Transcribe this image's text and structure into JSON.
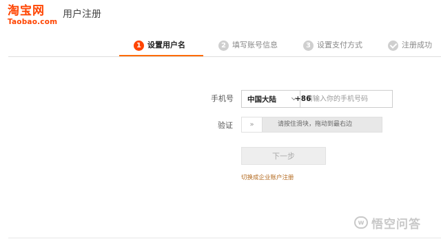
{
  "header": {
    "logo_cn": "淘宝网",
    "logo_en": "Taobao.com",
    "title": "用户注册"
  },
  "steps": [
    {
      "number": "1",
      "label": "设置用户名",
      "state": "active"
    },
    {
      "number": "2",
      "label": "填写账号信息",
      "state": "pending"
    },
    {
      "number": "3",
      "label": "设置支付方式",
      "state": "pending"
    },
    {
      "icon": "check-icon",
      "label": "注册成功",
      "state": "pending"
    }
  ],
  "form": {
    "phone_label": "手机号",
    "region_name": "中国大陆",
    "region_code": "+86",
    "phone_value": "",
    "phone_placeholder": "请输入你的手机号码",
    "verify_label": "验证",
    "slider_handle": "»",
    "slider_text": "请按住滑块，拖动到最右边",
    "next_label": "下一步",
    "company_link": "切换成企业账户注册"
  },
  "watermark": {
    "icon_text": "w",
    "text": "悟空问答"
  },
  "colors": {
    "brand": "#ff4400",
    "active_underline": "#ff6a00",
    "link": "#b36a1f",
    "inactive_step": "#cfcfcf"
  }
}
